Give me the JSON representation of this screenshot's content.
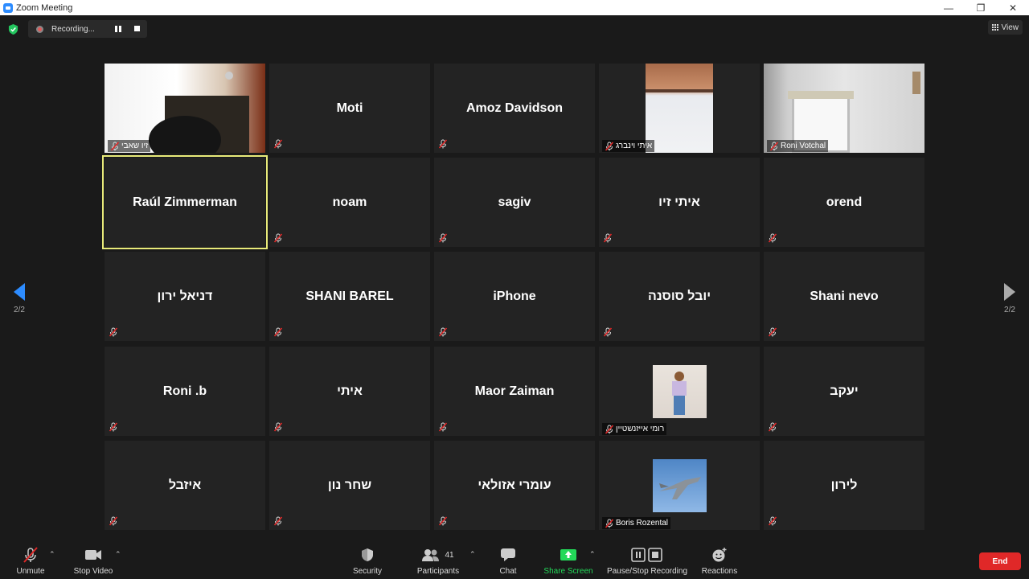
{
  "window": {
    "title": "Zoom Meeting",
    "minimize": "—",
    "restore": "❐",
    "close": "✕"
  },
  "top": {
    "recording_label": "Recording...",
    "view_label": "View"
  },
  "nav": {
    "page_left": "2/2",
    "page_right": "2/2"
  },
  "tiles": [
    {
      "name": "",
      "label": "זיו שאבי",
      "video": "room"
    },
    {
      "name": "Moti",
      "label": ""
    },
    {
      "name": "Amoz Davidson",
      "label": ""
    },
    {
      "name": "",
      "label": "איתי וינברג",
      "video": "wall"
    },
    {
      "name": "",
      "label": "Roni Votchal",
      "video": "window"
    },
    {
      "name": "Raúl Zimmerman",
      "label": "",
      "active": true,
      "nomute": true
    },
    {
      "name": "noam",
      "label": ""
    },
    {
      "name": "sagiv",
      "label": ""
    },
    {
      "name": "איתי זיו",
      "label": ""
    },
    {
      "name": "orend",
      "label": ""
    },
    {
      "name": "דניאל ירון",
      "label": ""
    },
    {
      "name": "SHANI BAREL",
      "label": ""
    },
    {
      "name": "iPhone",
      "label": ""
    },
    {
      "name": "יובל סוסנה",
      "label": ""
    },
    {
      "name": "Shani nevo",
      "label": ""
    },
    {
      "name": "Roni .b",
      "label": ""
    },
    {
      "name": "איתי",
      "label": ""
    },
    {
      "name": "Maor Zaiman",
      "label": ""
    },
    {
      "name": "",
      "label": "רומי אייזנשטיין",
      "video": "person"
    },
    {
      "name": "יעקב",
      "label": ""
    },
    {
      "name": "איזבל",
      "label": ""
    },
    {
      "name": "שחר נון",
      "label": ""
    },
    {
      "name": "עומרי אזולאי",
      "label": ""
    },
    {
      "name": "",
      "label": "Boris Rozental",
      "video": "jet"
    },
    {
      "name": "לירון",
      "label": ""
    }
  ],
  "toolbar": {
    "unmute": "Unmute",
    "stop_video": "Stop Video",
    "security": "Security",
    "participants": "Participants",
    "participants_count": "41",
    "chat": "Chat",
    "share_screen": "Share Screen",
    "pause_stop_recording": "Pause/Stop Recording",
    "reactions": "Reactions",
    "end": "End"
  },
  "colors": {
    "accent": "#2d8cff",
    "share_green": "#23d959",
    "end_red": "#e02828",
    "active_border": "#e8ea7a"
  }
}
